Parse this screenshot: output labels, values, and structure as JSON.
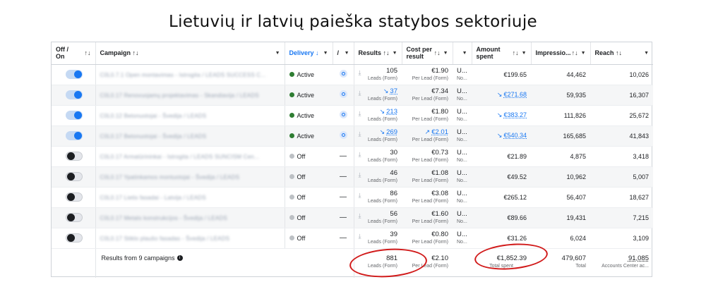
{
  "title": "Lietuvių ir latvių paieška statybos sektoriuje",
  "columns": {
    "off_on": "Off / On",
    "campaign": "Campaign",
    "delivery": "Delivery",
    "attr": "A",
    "results": "Results",
    "cost_per_result": "Cost per result",
    "amount_spent": "Amount spent",
    "impressions": "Impressio...",
    "reach": "Reach"
  },
  "rows": [
    {
      "on": true,
      "campaign": "C0L0.7.1 Open montavimas - Istrogita / LEADS SUCCESS C...",
      "delivery": "Active",
      "results": "105",
      "results_sub": "Leads (Form)",
      "cpr": "€1.90",
      "cpr_sub": "Per Lead (Form)",
      "u": "U...",
      "u_sub": "No...",
      "spent": "€199.65",
      "impressions": "44,462",
      "reach": "10,026"
    },
    {
      "on": true,
      "campaign": "C0L0.17 Renovuojamų projektavimas - Skandiavija / LEADS",
      "delivery": "Active",
      "results": "37",
      "results_sub": "Leads (Form)",
      "cpr": "€7.34",
      "cpr_sub": "Per Lead (Form)",
      "u": "U...",
      "u_sub": "No...",
      "spent": "€271.68",
      "impressions": "59,935",
      "reach": "16,307"
    },
    {
      "on": true,
      "campaign": "C0L0.12 Betonuotojai - Švedija / LEADS",
      "delivery": "Active",
      "results": "213",
      "results_sub": "Leads (Form)",
      "cpr": "€1.80",
      "cpr_sub": "Per Lead (Form)",
      "u": "U...",
      "u_sub": "No...",
      "spent": "€383.27",
      "impressions": "111,826",
      "reach": "25,672"
    },
    {
      "on": true,
      "campaign": "C0L0.17 Betonuotojai - Švedija / LEADS",
      "delivery": "Active",
      "results": "269",
      "results_sub": "Leads (Form)",
      "cpr": "€2.01",
      "cpr_sub": "Per Lead (Form)",
      "u": "U...",
      "u_sub": "No...",
      "spent": "€540.34",
      "impressions": "165,685",
      "reach": "41,843"
    },
    {
      "on": false,
      "campaign": "C0L0.17 Armatūrininkai - Istrogita / LEADS SUNCISM Cen...",
      "delivery": "Off",
      "results": "30",
      "results_sub": "Leads (Form)",
      "cpr": "€0.73",
      "cpr_sub": "Per Lead (Form)",
      "u": "U...",
      "u_sub": "No...",
      "spent": "€21.89",
      "impressions": "4,875",
      "reach": "3,418"
    },
    {
      "on": false,
      "campaign": "C0L0.17 Ypatinkamos montuotojai - Švedija / LEADS",
      "delivery": "Off",
      "results": "46",
      "results_sub": "Leads (Form)",
      "cpr": "€1.08",
      "cpr_sub": "Per Lead (Form)",
      "u": "U...",
      "u_sub": "No...",
      "spent": "€49.52",
      "impressions": "10,962",
      "reach": "5,007"
    },
    {
      "on": false,
      "campaign": "C0L0.17 Lietis fasadai - Latvija / LEADS",
      "delivery": "Off",
      "results": "86",
      "results_sub": "Leads (Form)",
      "cpr": "€3.08",
      "cpr_sub": "Per Lead (Form)",
      "u": "U...",
      "u_sub": "No...",
      "spent": "€265.12",
      "impressions": "56,407",
      "reach": "18,627"
    },
    {
      "on": false,
      "campaign": "C0L0.17 Metalo konstrukcijos - Švedija / LEADS",
      "delivery": "Off",
      "results": "56",
      "results_sub": "Leads (Form)",
      "cpr": "€1.60",
      "cpr_sub": "Per Lead (Form)",
      "u": "U...",
      "u_sub": "No...",
      "spent": "€89.66",
      "impressions": "19,431",
      "reach": "7,215"
    },
    {
      "on": false,
      "campaign": "C0L0.17 Stiklo plaušo fasadas - Švedija / LEADS",
      "delivery": "Off",
      "results": "39",
      "results_sub": "Leads (Form)",
      "cpr": "€0.80",
      "cpr_sub": "Per Lead (Form)",
      "u": "U...",
      "u_sub": "No...",
      "spent": "€31.26",
      "impressions": "6,024",
      "reach": "3,109"
    }
  ],
  "trend_rows": {
    "results": [
      1,
      2,
      3
    ],
    "cpr_up": [
      3
    ],
    "spent": [
      1,
      2,
      3
    ]
  },
  "footer": {
    "summary": "Results from 9 campaigns",
    "results": "881",
    "results_sub": "Leads (Form)",
    "cpr": "€2.10",
    "cpr_sub": "Per Lead (Form)",
    "spent": "€1,852.39",
    "spent_sub": "Total spent",
    "impressions": "479,607",
    "impressions_sub": "Total",
    "reach": "91,085",
    "reach_sub": "Accounts Center ac..."
  },
  "colors": {
    "accent": "#1877f2",
    "active": "#2e7d32",
    "annotation": "#d11a1a"
  }
}
